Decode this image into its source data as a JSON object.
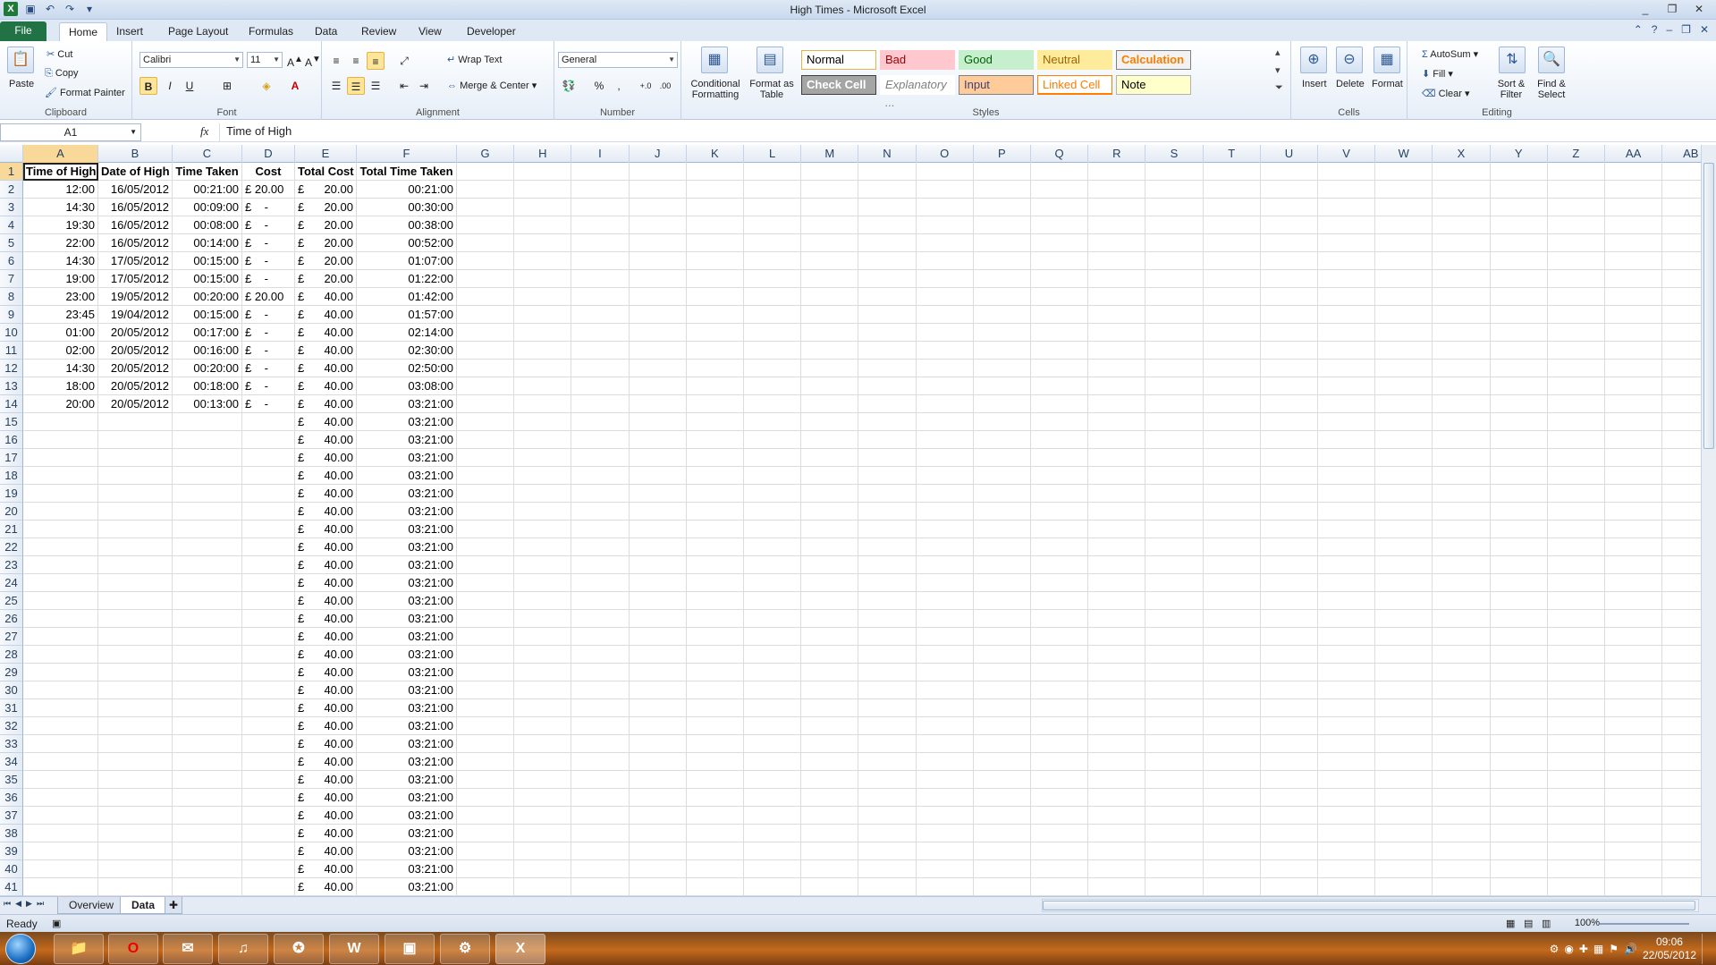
{
  "window": {
    "title": "High Times  -  Microsoft Excel"
  },
  "quick_access": {
    "save": "save-icon",
    "undo": "undo-icon",
    "redo": "redo-icon",
    "customize": "customize-icon"
  },
  "window_controls": {
    "minimize": "_",
    "restore": "❐",
    "close": "✕"
  },
  "tabs": [
    "File",
    "Home",
    "Insert",
    "Page Layout",
    "Formulas",
    "Data",
    "Review",
    "View",
    "Developer"
  ],
  "active_tab": "Home",
  "ribbon": {
    "clipboard": {
      "label": "Clipboard",
      "paste": "Paste",
      "cut": "Cut",
      "copy": "Copy",
      "format_painter": "Format Painter"
    },
    "font": {
      "label": "Font",
      "name": "Calibri",
      "size": "11",
      "bold": "B",
      "italic": "I",
      "underline": "U"
    },
    "alignment": {
      "label": "Alignment",
      "wrap_text": "Wrap Text",
      "merge_center": "Merge & Center"
    },
    "number": {
      "label": "Number",
      "format": "General",
      "percent": "%",
      "comma": ","
    },
    "styles": {
      "label": "Styles",
      "conditional_formatting": "Conditional Formatting",
      "format_as_table": "Format as Table",
      "items": [
        {
          "name": "Normal",
          "bg": "#ffffff",
          "color": "#000000",
          "border": "#e3b34a"
        },
        {
          "name": "Bad",
          "bg": "#ffc7ce",
          "color": "#9c0006",
          "border": "#ffc7ce"
        },
        {
          "name": "Good",
          "bg": "#c6efce",
          "color": "#006100",
          "border": "#c6efce"
        },
        {
          "name": "Neutral",
          "bg": "#ffeb9c",
          "color": "#9c6500",
          "border": "#ffeb9c"
        },
        {
          "name": "Calculation",
          "bg": "#f2f2f2",
          "color": "#fa7d00",
          "border": "#7f7f7f"
        },
        {
          "name": "Check Cell",
          "bg": "#a5a5a5",
          "color": "#ffffff",
          "border": "#3f3f3f"
        },
        {
          "name": "Explanatory ...",
          "bg": "#ffffff",
          "color": "#7f7f7f",
          "border": "#ffffff"
        },
        {
          "name": "Input",
          "bg": "#ffcc99",
          "color": "#3f3f76",
          "border": "#7f7f7f"
        },
        {
          "name": "Linked Cell",
          "bg": "#ffffff",
          "color": "#fa7d00",
          "border": "#ff8001"
        },
        {
          "name": "Note",
          "bg": "#ffffcc",
          "color": "#000000",
          "border": "#b2b2b2"
        }
      ]
    },
    "cells": {
      "label": "Cells",
      "insert": "Insert",
      "delete": "Delete",
      "format": "Format"
    },
    "editing": {
      "label": "Editing",
      "autosum": "AutoSum",
      "fill": "Fill",
      "clear": "Clear",
      "sort_filter": "Sort & Filter",
      "find_select": "Find & Select"
    }
  },
  "formula_bar": {
    "name_box": "A1",
    "fx": "fx",
    "content": "Time of High"
  },
  "columns": [
    "A",
    "B",
    "C",
    "D",
    "E",
    "F",
    "G",
    "H",
    "I",
    "J",
    "K",
    "L",
    "M",
    "N",
    "O",
    "P",
    "Q",
    "R",
    "S",
    "T",
    "U",
    "V",
    "W",
    "X",
    "Y",
    "Z",
    "AA",
    "AB"
  ],
  "headers": [
    "Time of High",
    "Date of High",
    "Time Taken",
    "Cost",
    "Total Cost",
    "Total Time Taken"
  ],
  "data_rows": [
    [
      "12:00",
      "16/05/2012",
      "00:21:00",
      "£ 20.00",
      "20.00",
      "00:21:00"
    ],
    [
      "14:30",
      "16/05/2012",
      "00:09:00",
      "£    -",
      "20.00",
      "00:30:00"
    ],
    [
      "19:30",
      "16/05/2012",
      "00:08:00",
      "£    -",
      "20.00",
      "00:38:00"
    ],
    [
      "22:00",
      "16/05/2012",
      "00:14:00",
      "£    -",
      "20.00",
      "00:52:00"
    ],
    [
      "14:30",
      "17/05/2012",
      "00:15:00",
      "£    -",
      "20.00",
      "01:07:00"
    ],
    [
      "19:00",
      "17/05/2012",
      "00:15:00",
      "£    -",
      "20.00",
      "01:22:00"
    ],
    [
      "23:00",
      "19/05/2012",
      "00:20:00",
      "£ 20.00",
      "40.00",
      "01:42:00"
    ],
    [
      "23:45",
      "19/04/2012",
      "00:15:00",
      "£    -",
      "40.00",
      "01:57:00"
    ],
    [
      "01:00",
      "20/05/2012",
      "00:17:00",
      "£    -",
      "40.00",
      "02:14:00"
    ],
    [
      "02:00",
      "20/05/2012",
      "00:16:00",
      "£    -",
      "40.00",
      "02:30:00"
    ],
    [
      "14:30",
      "20/05/2012",
      "00:20:00",
      "£    -",
      "40.00",
      "02:50:00"
    ],
    [
      "18:00",
      "20/05/2012",
      "00:18:00",
      "£    -",
      "40.00",
      "03:08:00"
    ],
    [
      "20:00",
      "20/05/2012",
      "00:13:00",
      "£    -",
      "40.00",
      "03:21:00"
    ]
  ],
  "fill_rows": {
    "total_cost": "40.00",
    "total_time": "03:21:00"
  },
  "sheets": [
    "Overview",
    "Data"
  ],
  "active_sheet": "Data",
  "status": {
    "ready": "Ready",
    "zoom": "100%"
  },
  "taskbar": {
    "time": "09:06",
    "date": "22/05/2012"
  }
}
